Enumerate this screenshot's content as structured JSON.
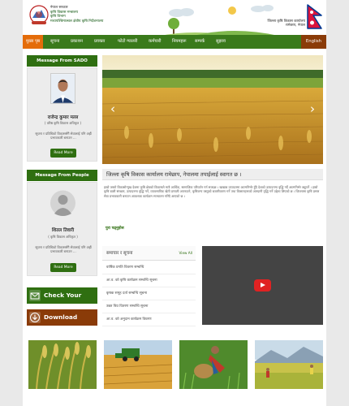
{
  "header": {
    "left_lines": [
      "नेपाल सरकार",
      "कृषि विकास मन्त्रालय",
      "कृषि विभाग",
      "मध्यपश्चिमाञ्चल क्षेत्रीय कृषि निर्देशनालय"
    ],
    "right_lines": [
      "जिल्ला कृषि विकास कार्यालय",
      "रामेछाप, नेपाल"
    ]
  },
  "nav": {
    "items": [
      "मुख्य पृष्ठ",
      "सूचना",
      "प्रकाशन",
      "प्रवक्ता",
      "फोटो ग्यालरी",
      "कर्मचारी",
      "नियमहरू",
      "सम्पर्क",
      "सुझाव"
    ],
    "english": "English"
  },
  "sado": {
    "heading": "Message From SADO",
    "name": "राजेन्द्र कुमार मल्ल",
    "role": "( वरिष्ठ कृषि विकास अधिकृत )",
    "message": "सूचना र प्रविधिको विकाससँगै सेवालाई पनि अझैं प्रभावकारी बनाउन ...",
    "read_more": "Read More"
  },
  "people": {
    "heading": "Message From People",
    "name": "शितल तिवारी",
    "role": "( कृषि विकास अधिकृत )",
    "message": "सूचना र प्रविधिको विकाससँगै सेवालाई पनि अझैं प्रभावकारी बनाउन ...",
    "read_more": "Read More"
  },
  "buttons": {
    "check_mail": "Check Your Mail",
    "download": "Download"
  },
  "welcome": {
    "title": "जिल्ला कृषि विकास कार्यालय रामेछाप, नेपालमा तपाईलाई स्वागत छ ।",
    "text": "हाम्रो जस्तो विकासोन्मुख देशमा कृषि क्षेत्रको विकासले मात्रै आर्थिक, सामाजिक परिवर्तन गर्न सक्दछ । खाद्यान्न उत्पादनमा आत्मनिर्भर हुँदै देशको उत्पादनमा वृद्धि गर्दै आत्मनिर्भर बन्नुपर्ने । हाम्रो कृषि बाली संरक्षण, उत्पादनमा वृद्धि गर्ने, व्यावसायिक खेती प्रणाली अपनाउने, कृषिजन्य वस्तुको बजारीकरण गर्ने तथा किसानहरूको आम्दानी वृद्धि गर्ने उद्देश्य लिएको छ । जिल्लामा कृषि प्रसार सेवा प्रभावकारी बनाउन आवश्यक कार्यक्रम सञ्चालन गरिंदै आएको छ ।",
    "read_more": "पुरा पढ्नुहोस"
  },
  "news": {
    "title": "समाचार र सूचना",
    "view_all": "View All",
    "items": [
      "वार्षिक प्रगति विवरण सम्बन्धि",
      "आ.व. को कृषि कार्यक्रम सम्बन्धि सूचना",
      "कृषक समूह दर्ता सम्बन्धि सूचना",
      "उन्नत बिउ वितरण सम्बन्धि सूचना",
      "आ.व. को अनुदान कार्यक्रम विवरण"
    ]
  },
  "colors": {
    "green": "#3a7a1b",
    "orange": "#e46c0a",
    "brown": "#8a3b08"
  }
}
